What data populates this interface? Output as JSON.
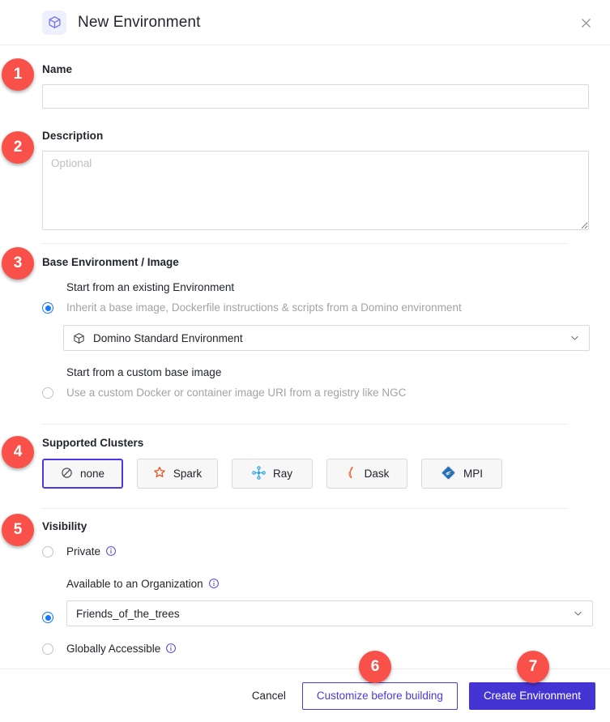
{
  "header": {
    "title": "New Environment",
    "icon": "cube-icon",
    "close_icon": "close-icon"
  },
  "form": {
    "name": {
      "label": "Name",
      "value": "",
      "placeholder": ""
    },
    "description": {
      "label": "Description",
      "value": "",
      "placeholder": "Optional"
    },
    "base_environment": {
      "section_title": "Base Environment / Image",
      "options": [
        {
          "title": "Start from an existing Environment",
          "description": "Inherit a base image, Dockerfile instructions & scripts from a Domino environment",
          "selected": true
        },
        {
          "title": "Start from a custom base image",
          "description": "Use a custom Docker or container image URI from a registry like NGC",
          "selected": false
        }
      ],
      "select": {
        "value": "Domino Standard Environment",
        "icon": "cube-icon",
        "chevron": "chevron-down-icon"
      }
    },
    "supported_clusters": {
      "section_title": "Supported Clusters",
      "chips": [
        {
          "label": "none",
          "icon": "no-entry-icon",
          "selected": true
        },
        {
          "label": "Spark",
          "icon": "spark-star-icon",
          "selected": false
        },
        {
          "label": "Ray",
          "icon": "ray-nodes-icon",
          "selected": false
        },
        {
          "label": "Dask",
          "icon": "dask-flame-icon",
          "selected": false
        },
        {
          "label": "MPI",
          "icon": "mpi-diamond-icon",
          "selected": false
        }
      ]
    },
    "visibility": {
      "section_title": "Visibility",
      "options": [
        {
          "label": "Private",
          "info_icon": "info-icon",
          "selected": false
        },
        {
          "label": "Available to an Organization",
          "info_icon": "info-icon",
          "selected": true
        },
        {
          "label": "Globally Accessible",
          "info_icon": "info-icon",
          "selected": false
        }
      ],
      "organization_select": {
        "value": "Friends_of_the_trees",
        "chevron": "chevron-down-icon"
      }
    }
  },
  "footer": {
    "cancel_label": "Cancel",
    "customize_label": "Customize before building",
    "create_label": "Create Environment"
  },
  "step_badges": [
    {
      "number": "1"
    },
    {
      "number": "2"
    },
    {
      "number": "3"
    },
    {
      "number": "4"
    },
    {
      "number": "5"
    },
    {
      "number": "6"
    },
    {
      "number": "7"
    }
  ],
  "colors": {
    "badge": "#f9504a",
    "primary": "#4434d4",
    "radio_selected": "#1677ff",
    "chip_selected_border": "#4b38e3",
    "info_icon": "#4b38e3"
  }
}
